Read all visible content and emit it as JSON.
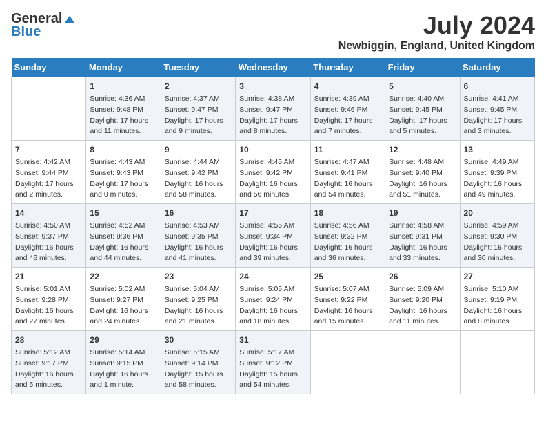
{
  "header": {
    "logo_general": "General",
    "logo_blue": "Blue",
    "month_title": "July 2024",
    "location": "Newbiggin, England, United Kingdom"
  },
  "calendar": {
    "days_of_week": [
      "Sunday",
      "Monday",
      "Tuesday",
      "Wednesday",
      "Thursday",
      "Friday",
      "Saturday"
    ],
    "weeks": [
      [
        {
          "day": "",
          "info": ""
        },
        {
          "day": "1",
          "info": "Sunrise: 4:36 AM\nSunset: 9:48 PM\nDaylight: 17 hours\nand 11 minutes."
        },
        {
          "day": "2",
          "info": "Sunrise: 4:37 AM\nSunset: 9:47 PM\nDaylight: 17 hours\nand 9 minutes."
        },
        {
          "day": "3",
          "info": "Sunrise: 4:38 AM\nSunset: 9:47 PM\nDaylight: 17 hours\nand 8 minutes."
        },
        {
          "day": "4",
          "info": "Sunrise: 4:39 AM\nSunset: 9:46 PM\nDaylight: 17 hours\nand 7 minutes."
        },
        {
          "day": "5",
          "info": "Sunrise: 4:40 AM\nSunset: 9:45 PM\nDaylight: 17 hours\nand 5 minutes."
        },
        {
          "day": "6",
          "info": "Sunrise: 4:41 AM\nSunset: 9:45 PM\nDaylight: 17 hours\nand 3 minutes."
        }
      ],
      [
        {
          "day": "7",
          "info": "Sunrise: 4:42 AM\nSunset: 9:44 PM\nDaylight: 17 hours\nand 2 minutes."
        },
        {
          "day": "8",
          "info": "Sunrise: 4:43 AM\nSunset: 9:43 PM\nDaylight: 17 hours\nand 0 minutes."
        },
        {
          "day": "9",
          "info": "Sunrise: 4:44 AM\nSunset: 9:42 PM\nDaylight: 16 hours\nand 58 minutes."
        },
        {
          "day": "10",
          "info": "Sunrise: 4:45 AM\nSunset: 9:42 PM\nDaylight: 16 hours\nand 56 minutes."
        },
        {
          "day": "11",
          "info": "Sunrise: 4:47 AM\nSunset: 9:41 PM\nDaylight: 16 hours\nand 54 minutes."
        },
        {
          "day": "12",
          "info": "Sunrise: 4:48 AM\nSunset: 9:40 PM\nDaylight: 16 hours\nand 51 minutes."
        },
        {
          "day": "13",
          "info": "Sunrise: 4:49 AM\nSunset: 9:39 PM\nDaylight: 16 hours\nand 49 minutes."
        }
      ],
      [
        {
          "day": "14",
          "info": "Sunrise: 4:50 AM\nSunset: 9:37 PM\nDaylight: 16 hours\nand 46 minutes."
        },
        {
          "day": "15",
          "info": "Sunrise: 4:52 AM\nSunset: 9:36 PM\nDaylight: 16 hours\nand 44 minutes."
        },
        {
          "day": "16",
          "info": "Sunrise: 4:53 AM\nSunset: 9:35 PM\nDaylight: 16 hours\nand 41 minutes."
        },
        {
          "day": "17",
          "info": "Sunrise: 4:55 AM\nSunset: 9:34 PM\nDaylight: 16 hours\nand 39 minutes."
        },
        {
          "day": "18",
          "info": "Sunrise: 4:56 AM\nSunset: 9:32 PM\nDaylight: 16 hours\nand 36 minutes."
        },
        {
          "day": "19",
          "info": "Sunrise: 4:58 AM\nSunset: 9:31 PM\nDaylight: 16 hours\nand 33 minutes."
        },
        {
          "day": "20",
          "info": "Sunrise: 4:59 AM\nSunset: 9:30 PM\nDaylight: 16 hours\nand 30 minutes."
        }
      ],
      [
        {
          "day": "21",
          "info": "Sunrise: 5:01 AM\nSunset: 9:28 PM\nDaylight: 16 hours\nand 27 minutes."
        },
        {
          "day": "22",
          "info": "Sunrise: 5:02 AM\nSunset: 9:27 PM\nDaylight: 16 hours\nand 24 minutes."
        },
        {
          "day": "23",
          "info": "Sunrise: 5:04 AM\nSunset: 9:25 PM\nDaylight: 16 hours\nand 21 minutes."
        },
        {
          "day": "24",
          "info": "Sunrise: 5:05 AM\nSunset: 9:24 PM\nDaylight: 16 hours\nand 18 minutes."
        },
        {
          "day": "25",
          "info": "Sunrise: 5:07 AM\nSunset: 9:22 PM\nDaylight: 16 hours\nand 15 minutes."
        },
        {
          "day": "26",
          "info": "Sunrise: 5:09 AM\nSunset: 9:20 PM\nDaylight: 16 hours\nand 11 minutes."
        },
        {
          "day": "27",
          "info": "Sunrise: 5:10 AM\nSunset: 9:19 PM\nDaylight: 16 hours\nand 8 minutes."
        }
      ],
      [
        {
          "day": "28",
          "info": "Sunrise: 5:12 AM\nSunset: 9:17 PM\nDaylight: 16 hours\nand 5 minutes."
        },
        {
          "day": "29",
          "info": "Sunrise: 5:14 AM\nSunset: 9:15 PM\nDaylight: 16 hours\nand 1 minute."
        },
        {
          "day": "30",
          "info": "Sunrise: 5:15 AM\nSunset: 9:14 PM\nDaylight: 15 hours\nand 58 minutes."
        },
        {
          "day": "31",
          "info": "Sunrise: 5:17 AM\nSunset: 9:12 PM\nDaylight: 15 hours\nand 54 minutes."
        },
        {
          "day": "",
          "info": ""
        },
        {
          "day": "",
          "info": ""
        },
        {
          "day": "",
          "info": ""
        }
      ]
    ]
  }
}
